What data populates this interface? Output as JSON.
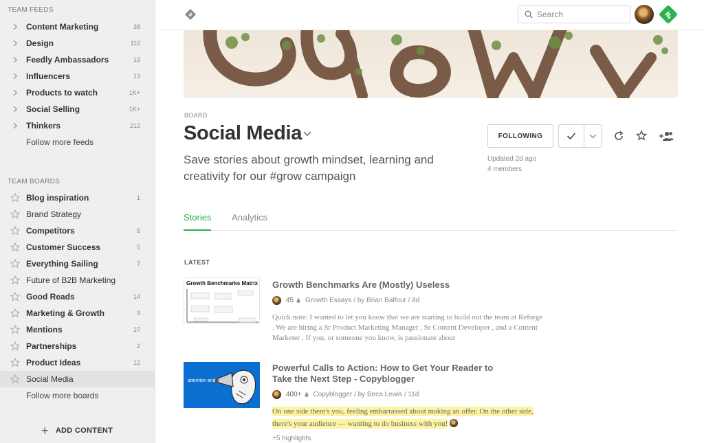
{
  "sidebar": {
    "team_feeds_title": "TEAM FEEDS",
    "feeds": [
      {
        "label": "Content Marketing",
        "count": "38"
      },
      {
        "label": "Design",
        "count": "116"
      },
      {
        "label": "Feedly Ambassadors",
        "count": "19"
      },
      {
        "label": "Influencers",
        "count": "13"
      },
      {
        "label": "Products to watch",
        "count": "1K+"
      },
      {
        "label": "Social Selling",
        "count": "1K+"
      },
      {
        "label": "Thinkers",
        "count": "212"
      }
    ],
    "follow_more_feeds": "Follow more feeds",
    "team_boards_title": "TEAM BOARDS",
    "boards": [
      {
        "label": "Blog inspiration",
        "count": "1"
      },
      {
        "label": "Brand Strategy",
        "count": ""
      },
      {
        "label": "Competitors",
        "count": "5"
      },
      {
        "label": "Customer Success",
        "count": "5"
      },
      {
        "label": "Everything Sailing",
        "count": "7"
      },
      {
        "label": "Future of B2B Marketing",
        "count": ""
      },
      {
        "label": "Good Reads",
        "count": "14"
      },
      {
        "label": "Marketing & Growth",
        "count": "9"
      },
      {
        "label": "Mentions",
        "count": "27"
      },
      {
        "label": "Partnerships",
        "count": "2"
      },
      {
        "label": "Product Ideas",
        "count": "12"
      },
      {
        "label": "Social Media",
        "count": ""
      }
    ],
    "follow_more_boards": "Follow more boards",
    "add_content": "ADD CONTENT"
  },
  "topbar": {
    "search_placeholder": "Search"
  },
  "board": {
    "kicker": "BOARD",
    "title": "Social Media",
    "description": "Save stories about growth mindset, learning and creativity for our #grow campaign",
    "following_label": "FOLLOWING",
    "updated": "Updated 2d ago",
    "members": "4 members"
  },
  "tabs": [
    "Stories",
    "Analytics"
  ],
  "latest_label": "LATEST",
  "articles": [
    {
      "thumb_title": "Growth Benchmarks Matrix",
      "title": "Growth Benchmarks Are (Mostly) Useless",
      "engagement": "45",
      "source": "Growth Essays / by Brian Balfour / 8d",
      "excerpt": "Quick note: I wanted to let you know that we are starting to build out the team at Reforge . We are hiring a Sr Product Marketing Manager , Sr Content Developer , and a Content Marketer . If you, or someone you know, is passionate about"
    },
    {
      "thumb_text": "attention and action",
      "title": "Powerful Calls to Action: How to Get Your Reader to Take the Next Step - Copyblogger",
      "engagement": "400+",
      "source": "Copyblogger / by Beca Lewis / 11d",
      "highlight": "On one side there's you, feeling embarrassed about making an offer. On the other side, there's your audience — wanting to do business with you!",
      "more_highlights": "+5 highlights"
    }
  ],
  "colors": {
    "accent_green": "#2bb24c",
    "highlight_yellow": "#fcf4a3",
    "thumb_blue": "#0b6fd1"
  }
}
